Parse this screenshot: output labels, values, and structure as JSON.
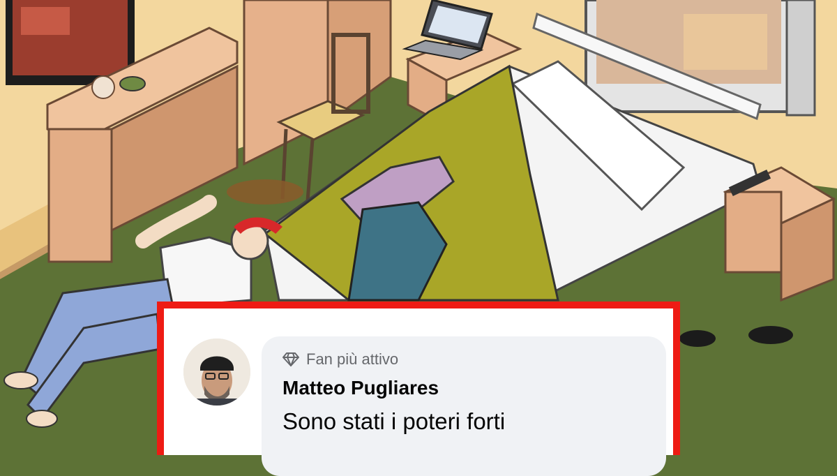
{
  "comment": {
    "badge_icon": "diamond-icon",
    "badge_label": "Fan più attivo",
    "author": "Matteo Pugliares",
    "text": "Sono stati i poteri forti"
  },
  "colors": {
    "highlight_border": "#ee1b14",
    "bubble_background": "#f0f2f5",
    "wall": "#f3d79e",
    "floor": "#5d7236"
  }
}
